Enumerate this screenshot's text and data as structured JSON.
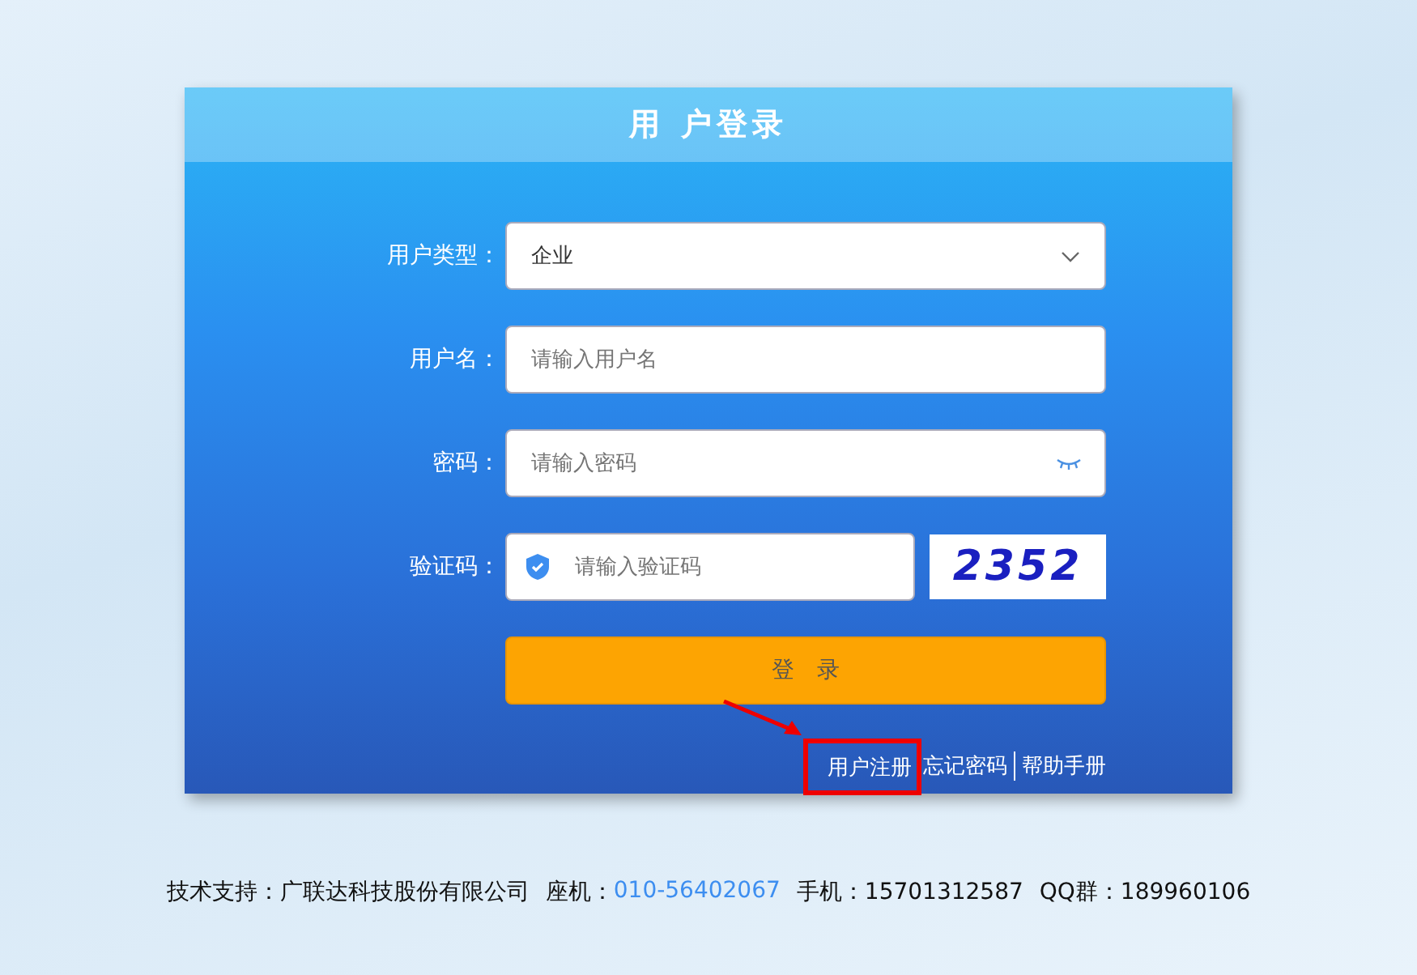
{
  "login": {
    "title": "用 户登录",
    "fields": [
      {
        "kind": "select",
        "label": "用户类型：",
        "value": "企业"
      },
      {
        "kind": "text",
        "label": "用户名：",
        "placeholder": "请输入用户名"
      },
      {
        "kind": "password",
        "label": "密码：",
        "placeholder": "请输入密码"
      },
      {
        "kind": "captcha",
        "label": "验证码：",
        "placeholder": "请输入验证码",
        "captcha": "2352"
      }
    ],
    "submit": "登　录",
    "links": [
      {
        "label": "用户注册",
        "highlighted": true
      },
      {
        "label": "忘记密码",
        "highlighted": false
      },
      {
        "label": "帮助手册",
        "highlighted": false
      }
    ]
  },
  "footer": {
    "parts": [
      {
        "kind": "plain",
        "text": "技术支持：广联达科技股份有限公司"
      },
      {
        "kind": "phone",
        "label": "座机：",
        "value": "010-56402067"
      },
      {
        "kind": "plain",
        "text": "手机：15701312587"
      },
      {
        "kind": "plain",
        "text": "QQ群：189960106"
      }
    ]
  }
}
